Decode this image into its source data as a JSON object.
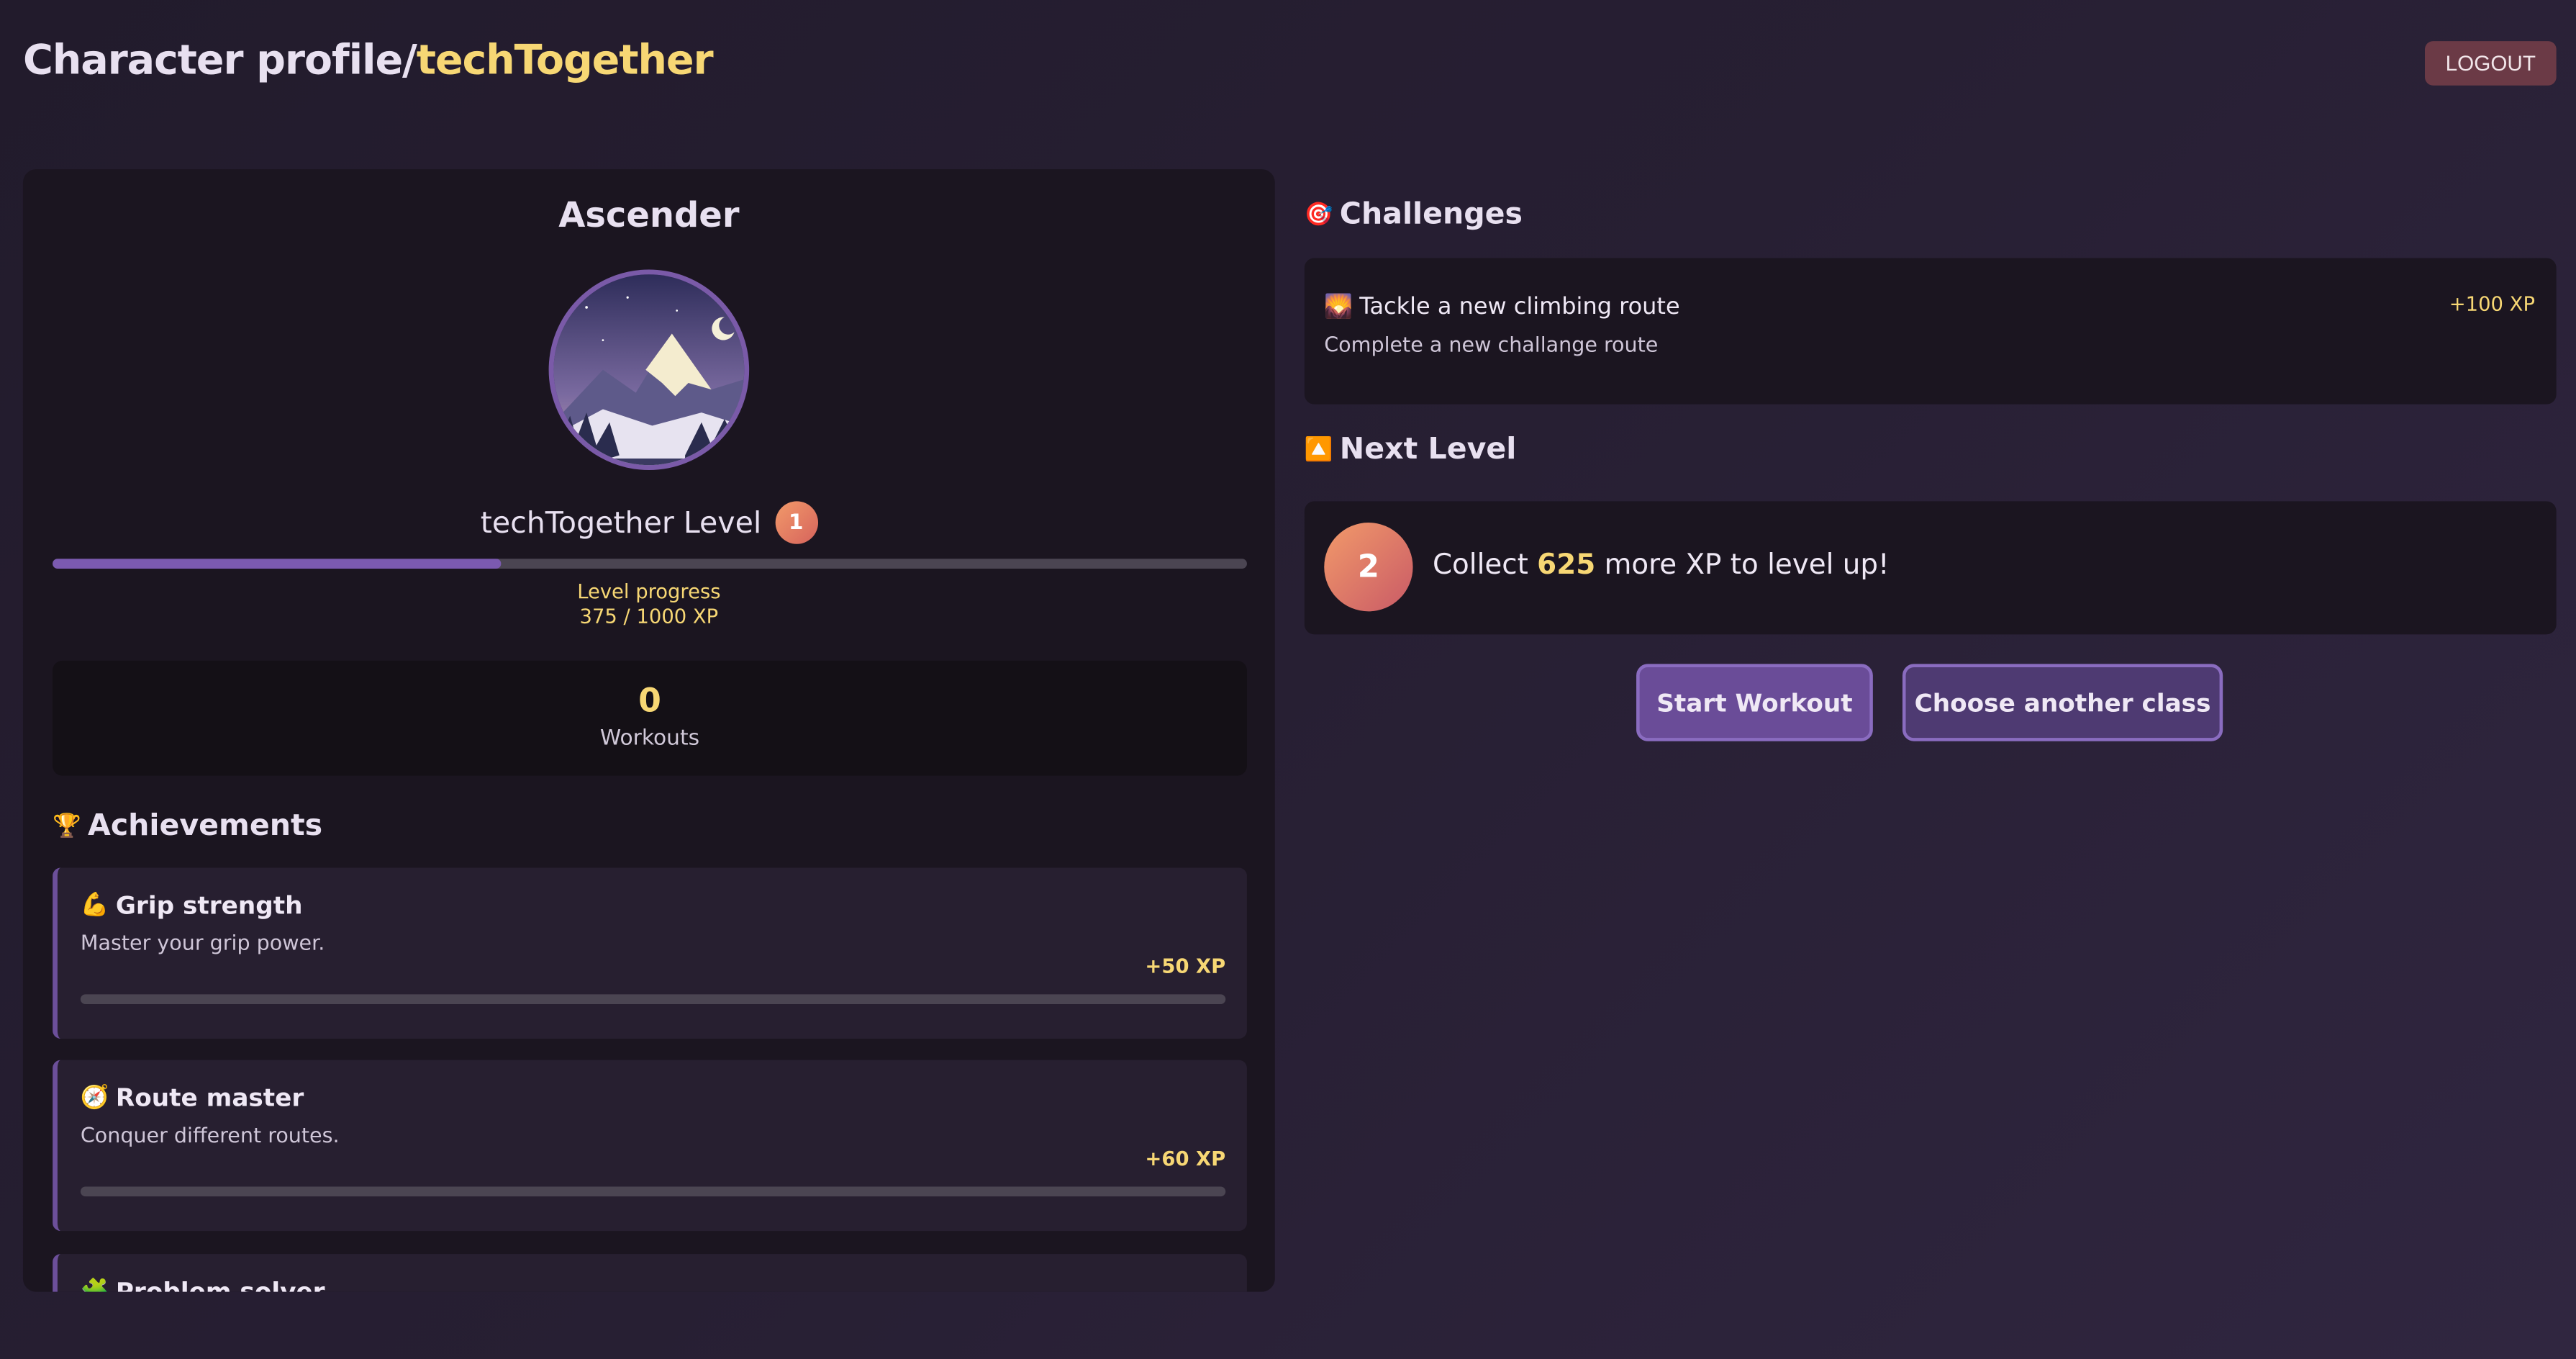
{
  "header": {
    "title_prefix": "Character profile/",
    "title_user": "techTogether",
    "logout_label": "LOGOUT"
  },
  "profile": {
    "class_name": "Ascender",
    "level_text": "techTogether Level",
    "level": "1",
    "xp_fraction": 0.375,
    "progress_label": "Level progress",
    "progress_value": "375 / 1000 XP",
    "workouts_count": "0",
    "workouts_label": "Workouts"
  },
  "achievements": {
    "title": "Achievements",
    "icon": "trophy-icon",
    "items": [
      {
        "title": "Grip strength",
        "icon": "flexed-biceps-icon",
        "description": "Master your grip power.",
        "xp": "+50 XP",
        "progress": 0
      },
      {
        "title": "Route master",
        "icon": "compass-icon",
        "description": "Conquer different routes.",
        "xp": "+60 XP",
        "progress": 0
      },
      {
        "title": "Problem solver",
        "icon": "puzzle-piece-icon"
      }
    ]
  },
  "challenges": {
    "title": "Challenges",
    "icon": "target-icon",
    "items": [
      {
        "title": "Tackle a new climbing route",
        "icon": "sunrise-over-mountains-icon",
        "description": "Complete a new challange route",
        "xp": "+100 XP"
      }
    ]
  },
  "next_level": {
    "title": "Next Level",
    "icon": "up-arrow-icon",
    "level": "2",
    "text_before": "Collect",
    "xp_needed": "625",
    "text_after": "more XP to level up!"
  },
  "actions": {
    "start_workout": "Start Workout",
    "choose_class": "Choose another class"
  },
  "colors": {
    "accent_gold": "#f7d774",
    "accent_purple": "#7b5ab0",
    "badge_orange": "#e67a62",
    "logout_bg": "#6b3a46"
  }
}
